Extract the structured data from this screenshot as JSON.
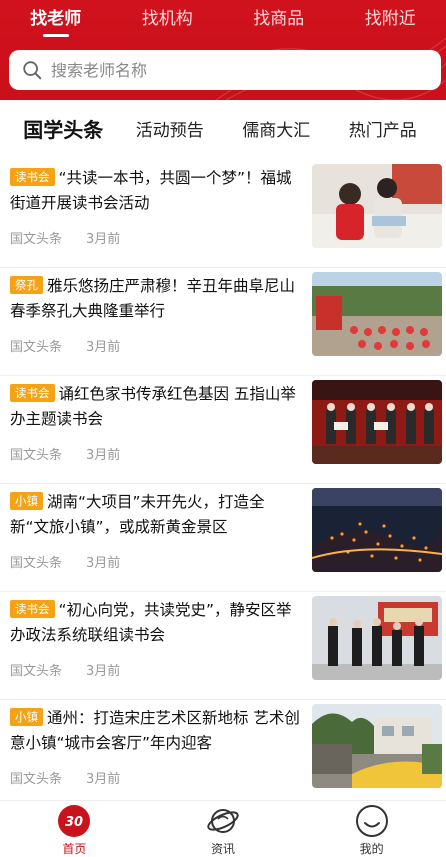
{
  "top_tabs": [
    "找老师",
    "找机构",
    "找商品",
    "找附近"
  ],
  "search": {
    "placeholder": "搜索老师名称"
  },
  "category_tabs": [
    "国学头条",
    "活动预告",
    "儒商大汇",
    "热门产品"
  ],
  "articles": [
    {
      "tag": "读书会",
      "title": "“共读一本书，共圆一个梦”！福城街道开展读书会活动",
      "source": "国文头条",
      "time": "3月前"
    },
    {
      "tag": "祭孔",
      "title": "雅乐悠扬庄严肃穆！辛丑年曲阜尼山春季祭孔大典隆重举行",
      "source": "国文头条",
      "time": "3月前"
    },
    {
      "tag": "读书会",
      "title": "诵红色家书传承红色基因 五指山举办主题读书会",
      "source": "国文头条",
      "time": "3月前"
    },
    {
      "tag": "小镇",
      "title": "湖南“大项目”未开先火，打造全新“文旅小镇”，或成新黄金景区",
      "source": "国文头条",
      "time": "3月前"
    },
    {
      "tag": "读书会",
      "title": "“初心向党，共读党史”，静安区举办政法系统联组读书会",
      "source": "国文头条",
      "time": "3月前"
    },
    {
      "tag": "小镇",
      "title": "通州：打造宋庄艺术区新地标 艺术创意小镇“城市会客厅”年内迎客",
      "source": "国文头条",
      "time": "3月前"
    }
  ],
  "bottom_nav": [
    {
      "label": "首页",
      "icon": "home-logo-icon"
    },
    {
      "label": "资讯",
      "icon": "planet-icon"
    },
    {
      "label": "我的",
      "icon": "smile-face-icon"
    }
  ],
  "colors": {
    "brand_red": "#c8121c",
    "tag_orange": "#f5a316"
  }
}
